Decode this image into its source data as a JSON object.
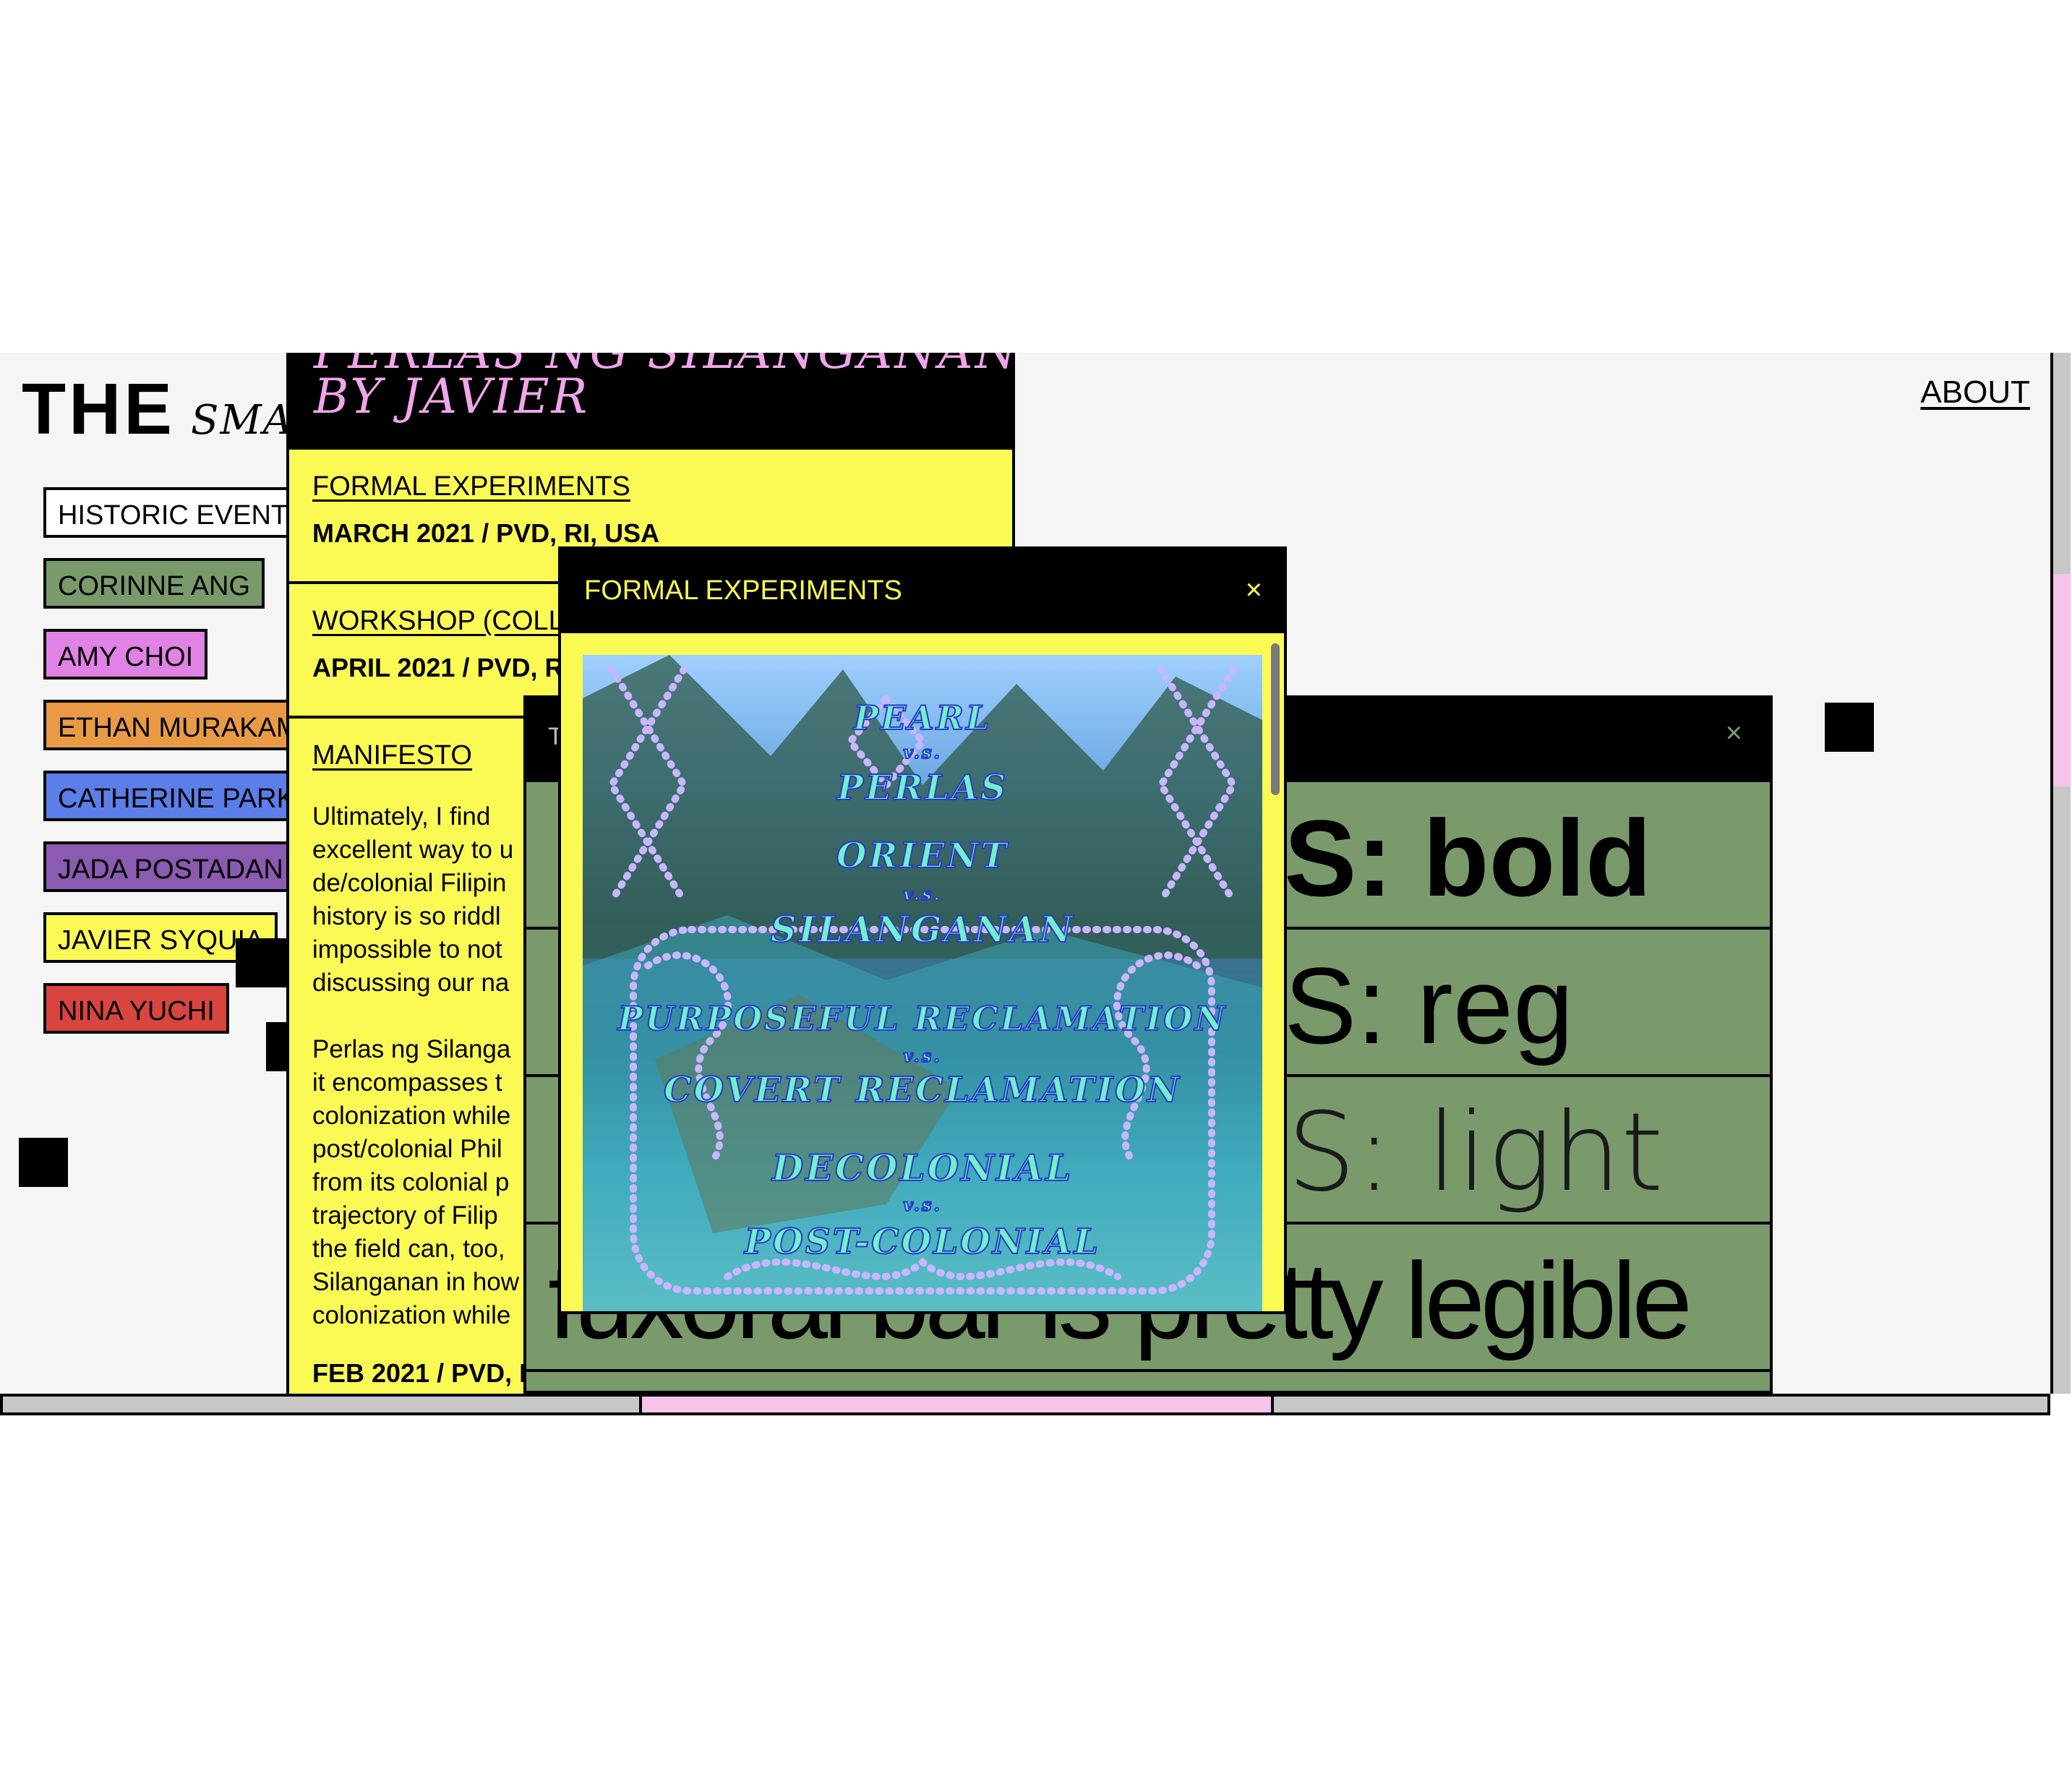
{
  "site": {
    "title_main": "THE",
    "title_sub": "SMA",
    "about_link": "ABOUT"
  },
  "tags": [
    {
      "label": "HISTORIC EVENT",
      "color": "#ffffff"
    },
    {
      "label": "CORINNE ANG",
      "color": "#7a9a6c"
    },
    {
      "label": "AMY CHOI",
      "color": "#e083e4"
    },
    {
      "label": "ETHAN MURAKAM",
      "color": "#e89a45"
    },
    {
      "label": "CATHERINE PARK",
      "color": "#5b7ee8"
    },
    {
      "label": "JADA POSTADAN",
      "color": "#8a5bb0"
    },
    {
      "label": "JAVIER SYQUIA",
      "color": "#fbfa55"
    },
    {
      "label": "NINA YUCHI",
      "color": "#d8453f"
    }
  ],
  "article": {
    "title_line1": "PERLAS NG SILANGANAN",
    "title_line2": "BY JAVIER",
    "sections": [
      {
        "link": "FORMAL EXPERIMENTS",
        "meta": "MARCH 2021 / PVD, RI, USA"
      },
      {
        "link": "WORKSHOP (COLLA",
        "meta": "APRIL 2021 / PVD, R"
      },
      {
        "link": "MANIFESTO",
        "meta": "FEB 2021 / PVD, R"
      }
    ],
    "manifesto_p1": "Ultimately, I find\nexcellent way to u\nde/colonial Filipin\nhistory is so riddl\nimpossible to not\ndiscussing our na",
    "manifesto_p2": "Perlas ng Silanga\nit encompasses t\ncolonization while\npost/colonial Phil\nfrom its colonial p\ntrajectory of Filip\nthe field can, too,\nSilanganan in how\ncolonization while"
  },
  "typeface_window": {
    "title": "T",
    "close": "×",
    "rows": [
      {
        "text": "NS: bold",
        "weight": "700"
      },
      {
        "text": "NS: reg",
        "weight": "400"
      },
      {
        "text": "NS: light",
        "weight": "300"
      },
      {
        "text": "fuxoral bar is pretty legible",
        "weight": "400"
      }
    ]
  },
  "modal": {
    "title": "FORMAL EXPERIMENTS",
    "close": "×",
    "artwork_lines": [
      "PEARL",
      "v.s.",
      "PERLAS",
      "ORIENT",
      "v.s.",
      "SILANGANAN",
      "PURPOSEFUL RECLAMATION",
      "v.s.",
      "COVERT RECLAMATION",
      "DECOLONIAL",
      "v.s.",
      "POST-COLONIAL"
    ]
  }
}
